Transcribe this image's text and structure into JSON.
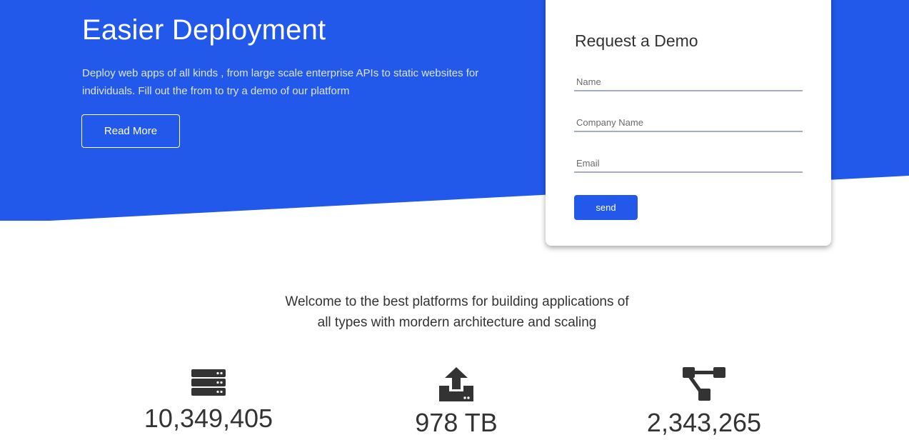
{
  "hero": {
    "title": "Easier Deployment",
    "description": "Deploy web apps of all kinds , from large scale enterprise APIs to static websites for individuals. Fill out the from to try a demo of our platform",
    "button_label": "Read More",
    "background_color": "#2359ea"
  },
  "demo_form": {
    "title": "Request a Demo",
    "fields": [
      {
        "placeholder": "Name",
        "value": ""
      },
      {
        "placeholder": "Company Name",
        "value": ""
      },
      {
        "placeholder": "Email",
        "value": ""
      }
    ],
    "submit_label": "send"
  },
  "welcome": {
    "text": "Welcome to the best platforms for building applications of all types with mordern architecture and scaling"
  },
  "stats": [
    {
      "icon": "server-icon",
      "value": "10,349,405"
    },
    {
      "icon": "upload-icon",
      "value": "978 TB"
    },
    {
      "icon": "network-icon",
      "value": "2,343,265"
    }
  ]
}
